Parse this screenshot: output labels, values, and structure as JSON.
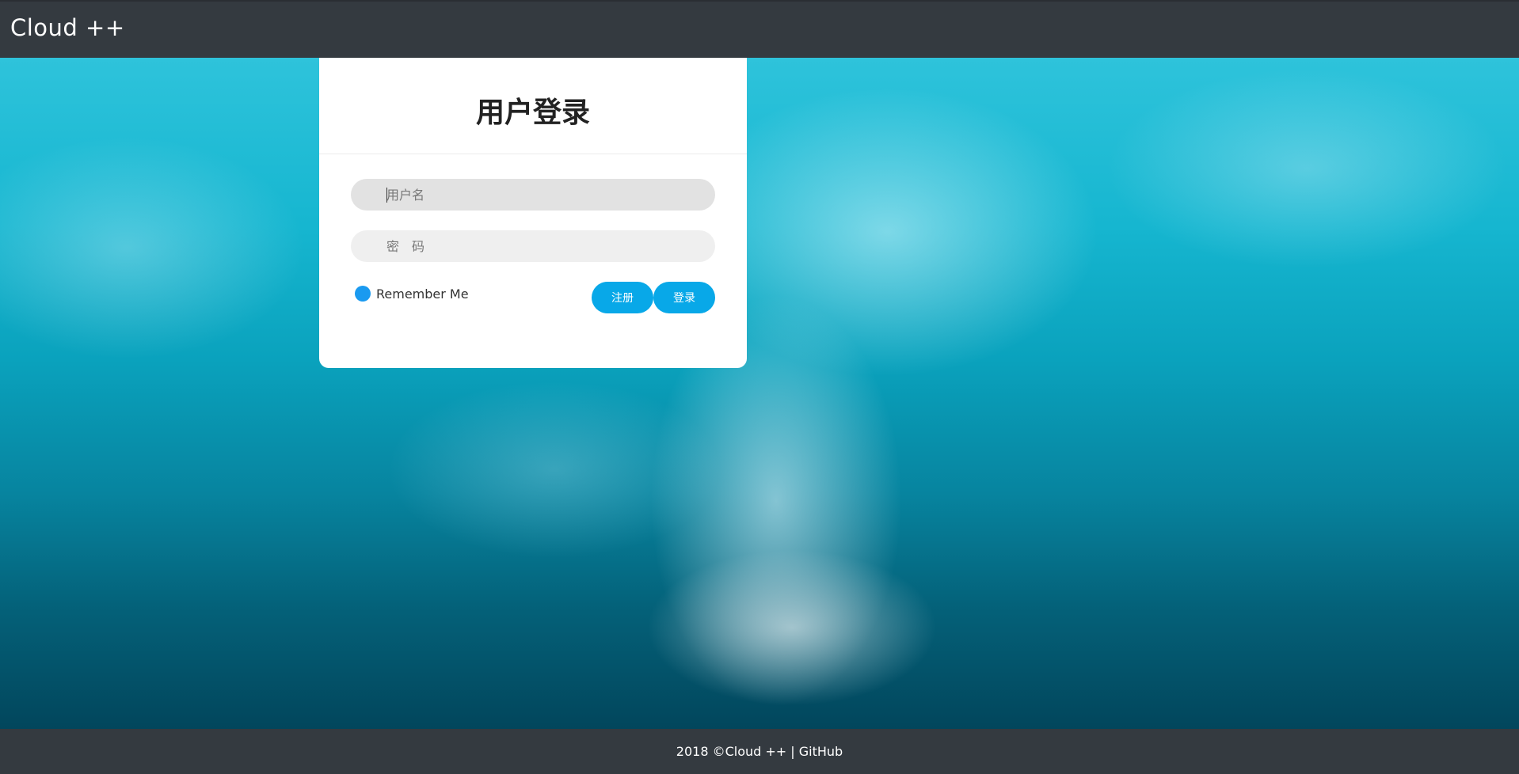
{
  "navbar": {
    "brand": "Cloud ++"
  },
  "login": {
    "title": "用户登录",
    "username_placeholder": "用户名",
    "password_placeholder": "密　码",
    "remember_label": "Remember Me",
    "register_label": "注册",
    "login_label": "登录"
  },
  "footer": {
    "copyright": "2018 ©Cloud ++ |",
    "github_label": "GitHub"
  },
  "colors": {
    "navbar_bg": "#343a40",
    "accent": "#08a8e8",
    "radio": "#1a9af0"
  }
}
